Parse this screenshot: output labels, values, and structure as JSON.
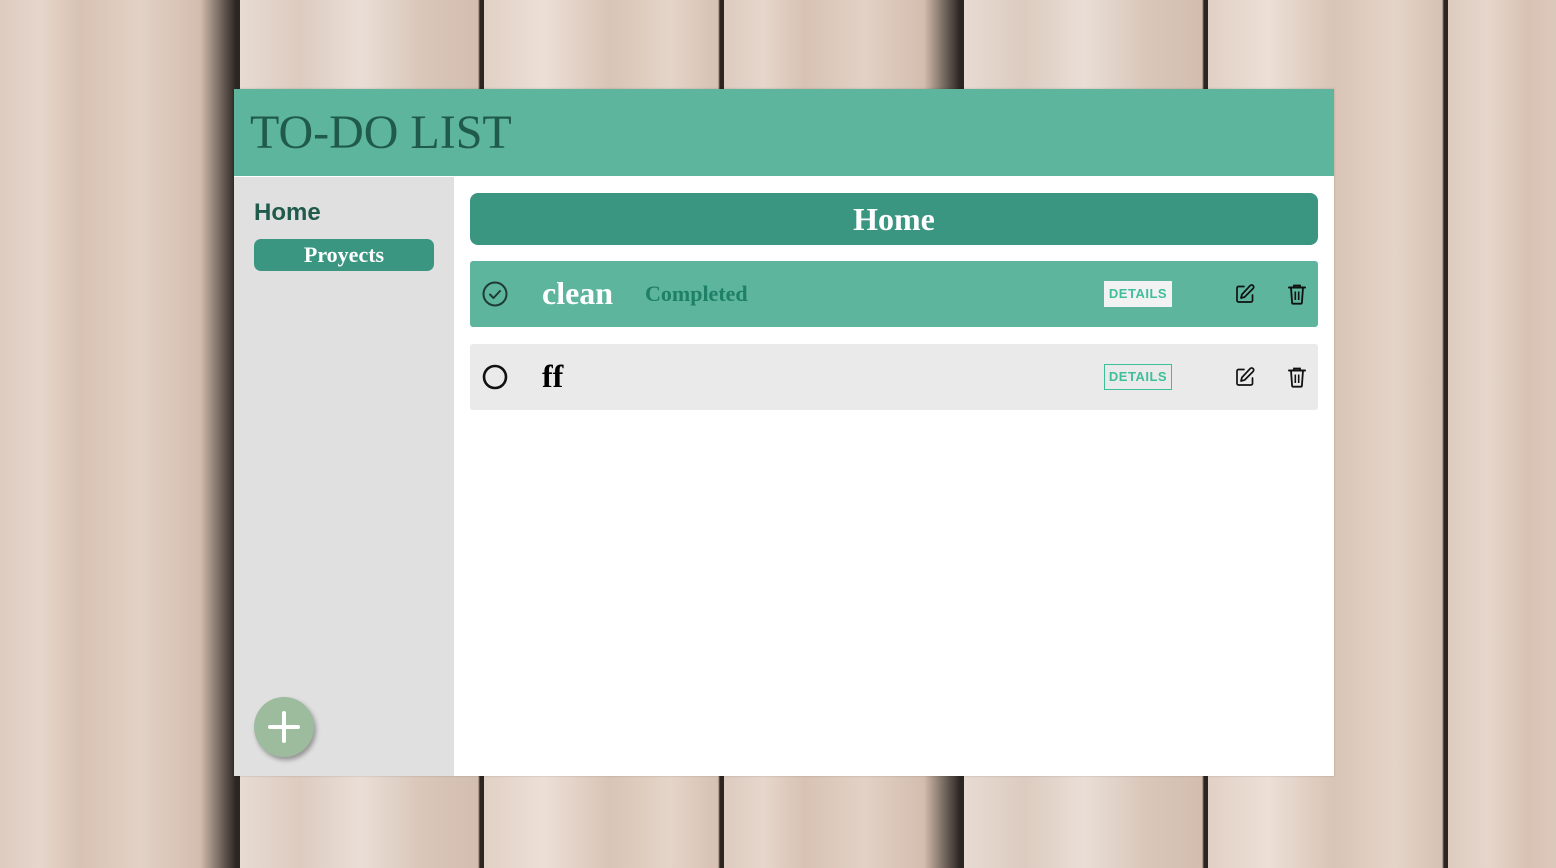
{
  "app": {
    "title": "TO-DO LIST"
  },
  "sidebar": {
    "items": [
      {
        "label": "Home"
      },
      {
        "label": "Proyects"
      }
    ],
    "add_icon": "plus-icon"
  },
  "main": {
    "section_title": "Home",
    "tasks": [
      {
        "name": "clean",
        "status": "Completed",
        "completed": true,
        "details_label": "DETAILS"
      },
      {
        "name": "ff",
        "status": "",
        "completed": false,
        "details_label": "DETAILS"
      }
    ]
  },
  "icons": {
    "completed_check": "check-circle-icon",
    "open_check": "circle-icon",
    "edit": "edit-icon",
    "delete": "trash-icon"
  },
  "colors": {
    "header": "#5db59d",
    "accent_dark": "#3a9680",
    "title_text": "#1f5a4a",
    "sidebar": "#e0e0e0",
    "add_button": "#9dbb9d",
    "details_text": "#3fbf99",
    "open_task_bg": "#eaeaea"
  }
}
